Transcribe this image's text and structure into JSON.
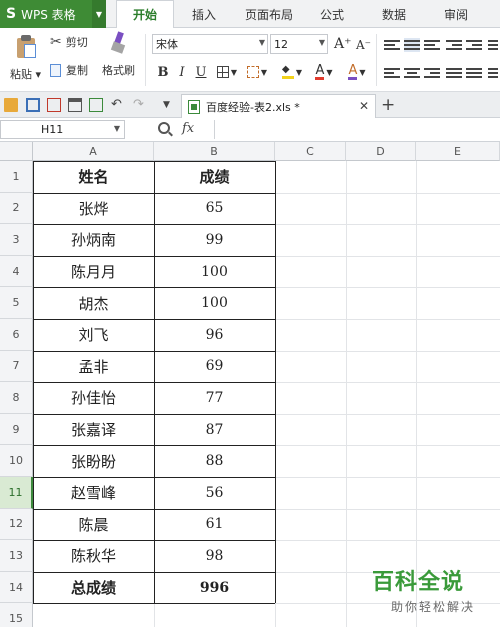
{
  "app": {
    "name": "WPS 表格",
    "logo": "S"
  },
  "tabs": [
    {
      "label": "开始",
      "active": true
    },
    {
      "label": "插入"
    },
    {
      "label": "页面布局"
    },
    {
      "label": "公式"
    },
    {
      "label": "数据"
    },
    {
      "label": "审阅"
    }
  ],
  "ribbon": {
    "paste": "粘贴",
    "cut": "剪切",
    "copy": "复制",
    "format_painter": "格式刷",
    "font_name": "宋体",
    "font_size": "12",
    "bold": "B",
    "italic": "I",
    "underline": "U",
    "grow_font": "A⁺",
    "shrink_font": "A⁻"
  },
  "document_tab": {
    "label": "百度经验-表2.xls *"
  },
  "formula_bar": {
    "name_box": "H11",
    "fx": "fx",
    "value": ""
  },
  "columns": [
    "A",
    "B",
    "C",
    "D",
    "E"
  ],
  "rows": [
    "1",
    "2",
    "3",
    "4",
    "5",
    "6",
    "7",
    "8",
    "9",
    "10",
    "11",
    "12",
    "13",
    "14",
    "15"
  ],
  "selected_row": "11",
  "table": {
    "header": [
      "姓名",
      "成绩"
    ],
    "data": [
      [
        "张烨",
        "65"
      ],
      [
        "孙炳南",
        "99"
      ],
      [
        "陈月月",
        "100"
      ],
      [
        "胡杰",
        "100"
      ],
      [
        "刘飞",
        "96"
      ],
      [
        "孟非",
        "69"
      ],
      [
        "孙佳怡",
        "77"
      ],
      [
        "张嘉译",
        "87"
      ],
      [
        "张盼盼",
        "88"
      ],
      [
        "赵雪峰",
        "56"
      ],
      [
        "陈晨",
        "61"
      ],
      [
        "陈秋华",
        "98"
      ]
    ],
    "total": [
      "总成绩",
      "996"
    ]
  },
  "watermark": {
    "title": "百科全说",
    "subtitle": "助你轻松解决"
  },
  "colors": {
    "accent": "#3e8b35",
    "selected_row": "#d9ead3"
  }
}
